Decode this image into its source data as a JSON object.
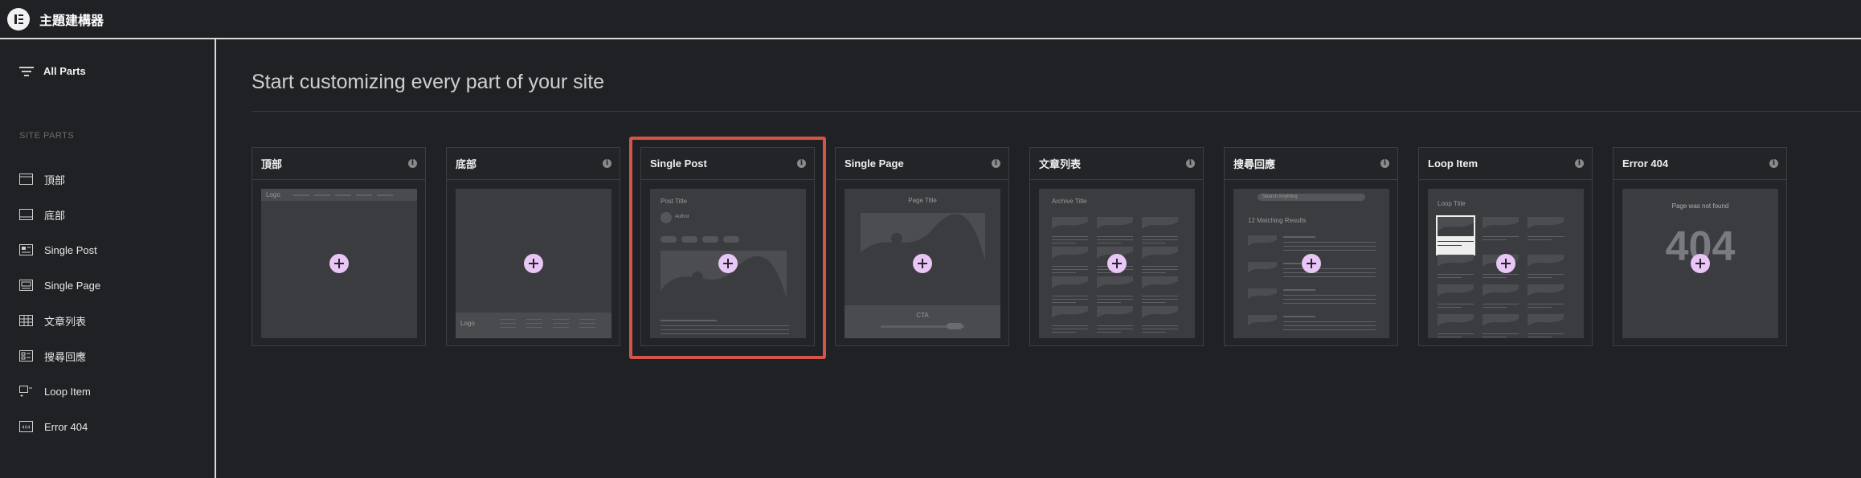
{
  "app": {
    "title": "主題建構器",
    "logo_icon": "elementor-logo-icon"
  },
  "sidebar": {
    "all_parts_label": "All Parts",
    "section_label": "SITE PARTS",
    "items": [
      {
        "label": "頂部",
        "icon": "header-icon"
      },
      {
        "label": "底部",
        "icon": "footer-icon"
      },
      {
        "label": "Single Post",
        "icon": "single-post-icon"
      },
      {
        "label": "Single Page",
        "icon": "single-page-icon"
      },
      {
        "label": "文章列表",
        "icon": "archive-icon"
      },
      {
        "label": "搜尋回應",
        "icon": "search-results-icon"
      },
      {
        "label": "Loop Item",
        "icon": "loop-item-icon"
      },
      {
        "label": "Error 404",
        "icon": "error-404-icon"
      }
    ]
  },
  "main": {
    "title": "Start customizing every part of your site",
    "cards": [
      {
        "title": "頂部",
        "preview": {
          "logo": "Logo"
        }
      },
      {
        "title": "底部",
        "preview": {
          "logo": "Logo"
        }
      },
      {
        "title": "Single Post",
        "highlighted": true,
        "preview": {
          "post_title": "Post Title",
          "author": "Author"
        }
      },
      {
        "title": "Single Page",
        "preview": {
          "page_title": "Page Title",
          "cta": "CTA"
        }
      },
      {
        "title": "文章列表",
        "preview": {
          "archive_title": "Archive Title"
        }
      },
      {
        "title": "搜尋回應",
        "preview": {
          "search_placeholder": "Search Anything",
          "results": "12 Matching Results"
        }
      },
      {
        "title": "Loop Item",
        "preview": {
          "loop_title": "Loop Title"
        }
      },
      {
        "title": "Error 404",
        "preview": {
          "not_found": "Page was not found",
          "code": "404"
        }
      }
    ]
  },
  "colors": {
    "accent_plus": "#e8c6f5",
    "highlight": "#d4544a",
    "background": "#202124"
  }
}
